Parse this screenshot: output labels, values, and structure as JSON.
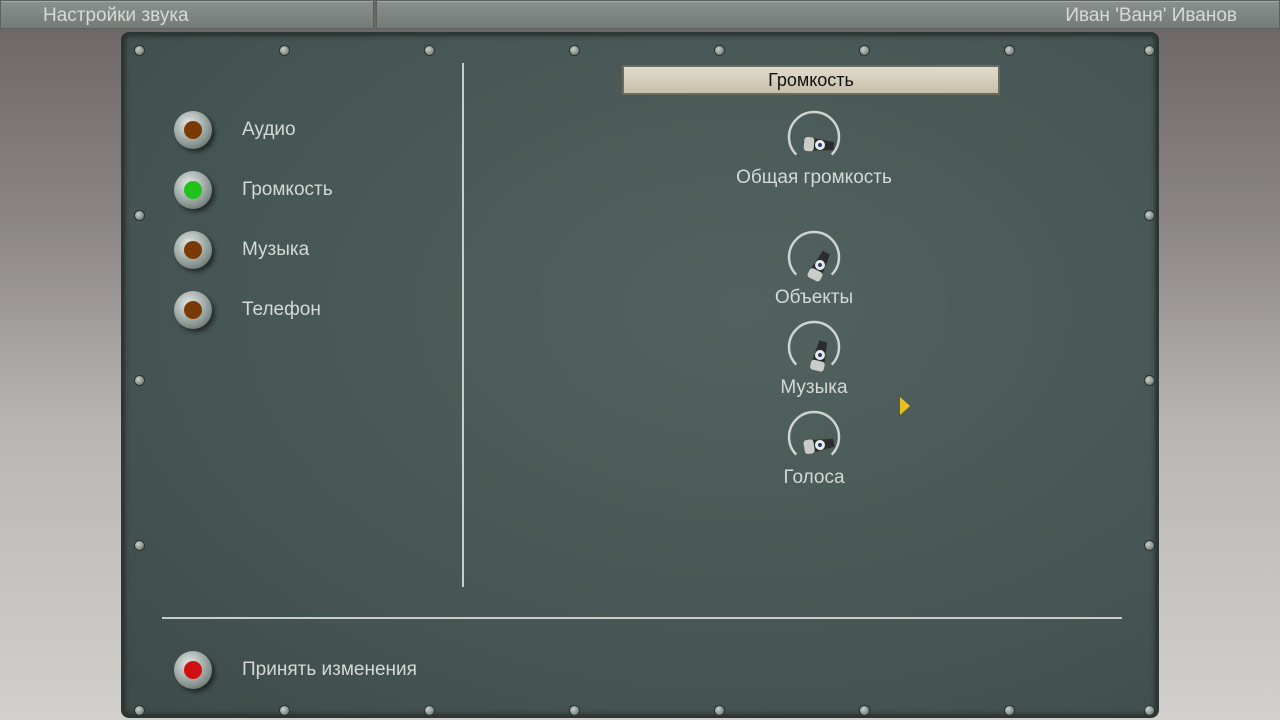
{
  "topbar": {
    "title": "Настройки звука",
    "user": "Иван 'Ваня' Иванов"
  },
  "sidebar": {
    "items": [
      {
        "label": "Аудио",
        "lamp_color": "#7a3a05",
        "active": false
      },
      {
        "label": "Громкость",
        "lamp_color": "#22c21e",
        "active": true
      },
      {
        "label": "Музыка",
        "lamp_color": "#7a3a05",
        "active": false
      },
      {
        "label": "Телефон",
        "lamp_color": "#7a3a05",
        "active": false
      }
    ]
  },
  "section_title": "Громкость",
  "knobs": [
    {
      "label": "Общая громкость",
      "value": 0.85
    },
    {
      "label": "Объекты",
      "value": 0.6
    },
    {
      "label": "Музыка",
      "value": 0.55
    },
    {
      "label": "Голоса",
      "value": 0.8
    }
  ],
  "apply": {
    "label": "Принять изменения",
    "lamp_color": "#d01010"
  }
}
